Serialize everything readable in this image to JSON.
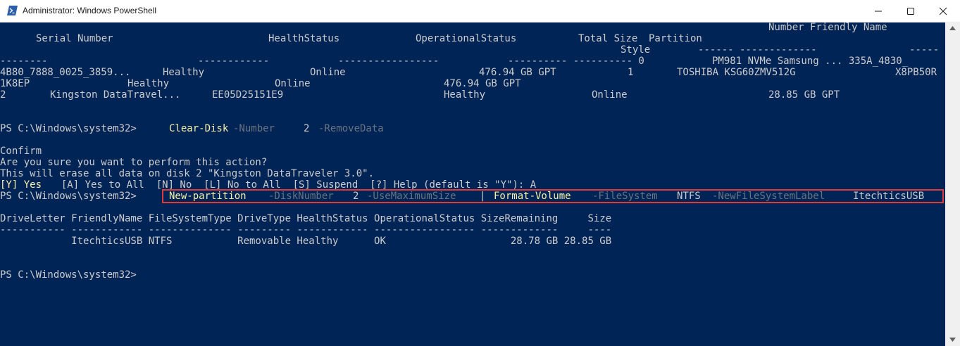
{
  "window": {
    "title": "Administrator: Windows PowerShell",
    "icon": "powershell-icon",
    "controls": [
      "minimize-icon",
      "maximize-icon",
      "close-icon"
    ]
  },
  "console": {
    "disk_table": {
      "line1": "Number Friendly Name",
      "headers": [
        "Serial Number",
        "HealthStatus",
        "OperationalStatus",
        "Total Size",
        "Partition"
      ],
      "style_label": "Style",
      "dash_lines": [
        "--------",
        "------------",
        "-----------------",
        "---------- ---------- 0",
        "------ -------------",
        "-----"
      ],
      "row0_name": "PM981 NVMe Samsung ... 335A_4830_",
      "row0_serial": "4B80_7888_0025_3859...",
      "row0_health": "Healthy",
      "row0_op": "Online",
      "row0_size": "476.94 GB GPT",
      "row1_number": "1",
      "row1_name": "TOSHIBA KSG60ZMV512G",
      "row1_serial_tail": "X8PB50R",
      "row1_serial": "1K8EP",
      "row1_health": "Healthy",
      "row1_op": "Online",
      "row1_size": "476.94 GB GPT",
      "row2_number": "2",
      "row2_name": "Kingston DataTravel...",
      "row2_serial": "EE05D25151E9",
      "row2_health": "Healthy",
      "row2_op": "Online",
      "row2_size": "28.85 GB GPT"
    },
    "prompt": "PS C:\\Windows\\system32>",
    "command1": {
      "cmdlet": "Clear-Disk",
      "param1": "-Number",
      "value1": "2",
      "param2": "-RemoveData"
    },
    "confirm": {
      "title": "Confirm",
      "question": "Are you sure you want to perform this action?",
      "detail": "This will erase all data on disk 2 \"Kingston DataTraveler 3.0\".",
      "choice_yes": "[Y] Yes",
      "choice_rest": "  [A] Yes to All  [N] No  [L] No to All  [S] Suspend  [?] Help (default is \"Y\"): A"
    },
    "command2": {
      "cmdlet": "New-partition",
      "param1": "-DiskNumber",
      "value1": "2",
      "param2": "-UseMaximumSize",
      "pipe": "|",
      "cmdlet2": "Format-Volume",
      "param3": "-FileSystem",
      "value3": "NTFS",
      "param4": "-NewFileSystemLabel",
      "value4": "ItechticsUSB"
    },
    "volume_table": {
      "header": "DriveLetter FriendlyName FileSystemType DriveType HealthStatus OperationalStatus SizeRemaining     Size",
      "dashes": "----------- ------------ -------------- --------- ------------ ----------------- -------------     ----",
      "row": "            ItechticsUSB NTFS           Removable Healthy      OK                     28.78 GB 28.85 GB"
    }
  },
  "colors": {
    "console_bg": "#012456",
    "text": "#cccccc",
    "command": "#f9f1a5",
    "parameter": "#6a7480",
    "highlight_border": "#e03a3a"
  }
}
